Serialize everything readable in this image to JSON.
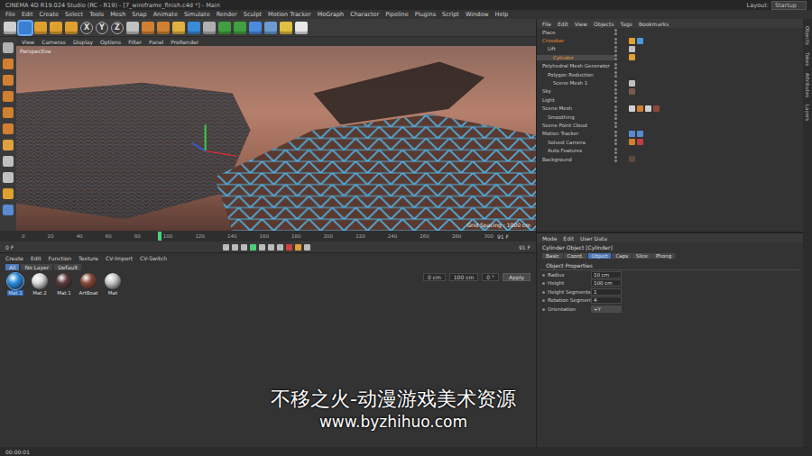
{
  "window": {
    "title": "CINEMA 4D R19.024 Studio (RC - R19) - [7_wireframe_finish.c4d *] - Main",
    "layout_label": "Layout:",
    "layout_value": "Startup"
  },
  "menu": [
    "File",
    "Edit",
    "Create",
    "Select",
    "Tools",
    "Mesh",
    "Snap",
    "Animate",
    "Simulate",
    "Render",
    "Sculpt",
    "Motion Tracker",
    "MoGraph",
    "Character",
    "Pipeline",
    "Plugins",
    "Script",
    "Window",
    "Help"
  ],
  "toolbar": [
    {
      "kind": "icon",
      "color": "#d0d0d0",
      "selected": false
    },
    {
      "kind": "icon",
      "color": "#3a7fd0",
      "selected": true
    },
    {
      "kind": "icon",
      "color": "#e0a030",
      "selected": false
    },
    {
      "kind": "icon",
      "color": "#e0a030",
      "selected": false
    },
    {
      "kind": "icon",
      "color": "#e0a030",
      "selected": false
    },
    {
      "kind": "text",
      "label": "X",
      "selected": false
    },
    {
      "kind": "text",
      "label": "Y",
      "selected": false
    },
    {
      "kind": "text",
      "label": "Z",
      "selected": false
    },
    {
      "kind": "icon",
      "color": "#c0c0c0",
      "selected": false
    },
    {
      "kind": "icon",
      "color": "#d08030",
      "selected": false
    },
    {
      "kind": "icon",
      "color": "#d08030",
      "selected": false
    },
    {
      "kind": "icon",
      "color": "#e0b040",
      "selected": false
    },
    {
      "kind": "icon",
      "color": "#3a8ad8",
      "selected": false
    },
    {
      "kind": "icon",
      "color": "#b0b0b0",
      "selected": false
    },
    {
      "kind": "icon",
      "color": "#40a040",
      "selected": false
    },
    {
      "kind": "icon",
      "color": "#40a040",
      "selected": false
    },
    {
      "kind": "icon",
      "color": "#4a8ae0",
      "selected": false
    },
    {
      "kind": "icon",
      "color": "#6a9ad0",
      "selected": false
    },
    {
      "kind": "icon",
      "color": "#e0c040",
      "selected": false
    },
    {
      "kind": "icon",
      "color": "#e8e8e8",
      "selected": false
    }
  ],
  "side_tools": [
    {
      "color": "#b0b0b0"
    },
    {
      "color": "#d08030"
    },
    {
      "color": "#d08030"
    },
    {
      "color": "#d08030"
    },
    {
      "color": "#d08030"
    },
    {
      "color": "#d08030"
    },
    {
      "color": "#e0a040"
    },
    {
      "color": "#c0c0c0"
    },
    {
      "color": "#c0c0c0"
    },
    {
      "color": "#e0a030"
    },
    {
      "color": "#5a8ad0"
    }
  ],
  "viewport": {
    "menu": [
      "View",
      "Cameras",
      "Display",
      "Options",
      "Filter",
      "Panel",
      "ProRender"
    ],
    "camera": "Perspective",
    "grid": "Grid Spacing : 1000 cm"
  },
  "timeline": {
    "ticks": [
      "0",
      "20",
      "40",
      "60",
      "80",
      "100",
      "120",
      "140",
      "160",
      "180",
      "200",
      "220",
      "240",
      "260",
      "280",
      "300"
    ],
    "playhead": 0.3,
    "end_label": "91 F"
  },
  "playback": {
    "start": "0 F",
    "end": "91 F"
  },
  "materials": {
    "menu": [
      "Create",
      "Edit",
      "Function",
      "Texture",
      "CV-Import",
      "CV-Switch"
    ],
    "filters": [
      {
        "label": "All",
        "selected": true
      },
      {
        "label": "No Layer",
        "selected": false
      },
      {
        "label": "Default",
        "selected": false
      }
    ],
    "items": [
      {
        "name": "Mat.1",
        "color": "#2a8ee0",
        "selected": true
      },
      {
        "name": "Mat.2",
        "color": "#d8d8d8",
        "selected": false
      },
      {
        "name": "Mat.1",
        "color": "#5a3a3a",
        "selected": false
      },
      {
        "name": "ArtBoat",
        "color": "#8a4a3a",
        "selected": false
      },
      {
        "name": "Mat",
        "color": "#c8c8c8",
        "selected": false
      }
    ]
  },
  "coords": {
    "fields": [
      "0 cm",
      "100 cm",
      "0 °"
    ],
    "apply": "Apply"
  },
  "objects": {
    "menu": [
      "File",
      "Edit",
      "View",
      "Objects",
      "Tags",
      "Bookmarks"
    ],
    "rows": [
      {
        "name": "Place",
        "depth": 0,
        "selected": false,
        "color": "#c8c8c8",
        "tags": []
      },
      {
        "name": "Crossbar",
        "depth": 0,
        "selected": false,
        "color": "#e08a30",
        "tags": [
          "#e0a030",
          "#4a9ae0"
        ]
      },
      {
        "name": "Lift",
        "depth": 1,
        "selected": false,
        "color": "#c8c8c8",
        "tags": [
          "#c0c0c0"
        ]
      },
      {
        "name": "Cylinder",
        "depth": 2,
        "selected": true,
        "color": "#e8a040",
        "tags": [
          "#e0a030"
        ]
      },
      {
        "name": "Polyhedral Mesh Generator",
        "depth": 0,
        "selected": false,
        "color": "#c8c8c8",
        "tags": []
      },
      {
        "name": "Polygon Reduction",
        "depth": 1,
        "selected": false,
        "color": "#c8c8c8",
        "tags": []
      },
      {
        "name": "Scene Mesh 1",
        "depth": 2,
        "selected": false,
        "color": "#c8c8c8",
        "tags": [
          "#c0c0c0"
        ]
      },
      {
        "name": "Sky",
        "depth": 0,
        "selected": false,
        "color": "#c8c8c8",
        "tags": [
          "#7a5a50"
        ]
      },
      {
        "name": "Light",
        "depth": 0,
        "selected": false,
        "color": "#c8c8c8",
        "tags": []
      },
      {
        "name": "Scene Mesh",
        "depth": 0,
        "selected": false,
        "color": "#c8c8c8",
        "tags": [
          "#d0d0d0",
          "#d08030",
          "#d0d0d0",
          "#8a4a3a"
        ]
      },
      {
        "name": "Smoothing",
        "depth": 1,
        "selected": false,
        "color": "#c8c8c8",
        "tags": []
      },
      {
        "name": "Scene Point Cloud",
        "depth": 0,
        "selected": false,
        "color": "#c8c8c8",
        "tags": []
      },
      {
        "name": "Motion Tracker",
        "depth": 0,
        "selected": false,
        "color": "#c8c8c8",
        "tags": [
          "#5a8ad0",
          "#5a8ad0"
        ]
      },
      {
        "name": "Solved Camera",
        "depth": 1,
        "selected": false,
        "color": "#c8c8c8",
        "tags": [
          "#d08030",
          "#c04040"
        ]
      },
      {
        "name": "Auto Features",
        "depth": 1,
        "selected": false,
        "color": "#c8c8c8",
        "tags": []
      },
      {
        "name": "Background",
        "depth": 0,
        "selected": false,
        "color": "#c8c8c8",
        "tags": [
          "#5a4a40"
        ]
      }
    ]
  },
  "attributes": {
    "menu": [
      "Mode",
      "Edit",
      "User Data"
    ],
    "title": "Cylinder Object [Cylinder]",
    "tabs": [
      {
        "label": "Basic",
        "selected": false
      },
      {
        "label": "Coord.",
        "selected": false
      },
      {
        "label": "Object",
        "selected": true
      },
      {
        "label": "Caps",
        "selected": false
      },
      {
        "label": "Slice",
        "selected": false
      },
      {
        "label": "Phong",
        "selected": false
      }
    ],
    "section": "Object Properties",
    "fields": [
      {
        "label": "Radius",
        "value": "10 cm",
        "kind": "number"
      },
      {
        "label": "Height",
        "value": "100 cm",
        "kind": "number"
      },
      {
        "label": "Height Segments",
        "value": "1",
        "kind": "number"
      },
      {
        "label": "Rotation Segments",
        "value": "4",
        "kind": "number"
      },
      {
        "label": "Orientation",
        "value": "+Y",
        "kind": "dropdown"
      }
    ]
  },
  "side_tabs": [
    "Objects",
    "Takes",
    "Attributes",
    "Layers"
  ],
  "status": "00:00:01",
  "watermark": {
    "title": "不移之火-动漫游戏美术资源",
    "url": "www.byzhihuo.com"
  }
}
